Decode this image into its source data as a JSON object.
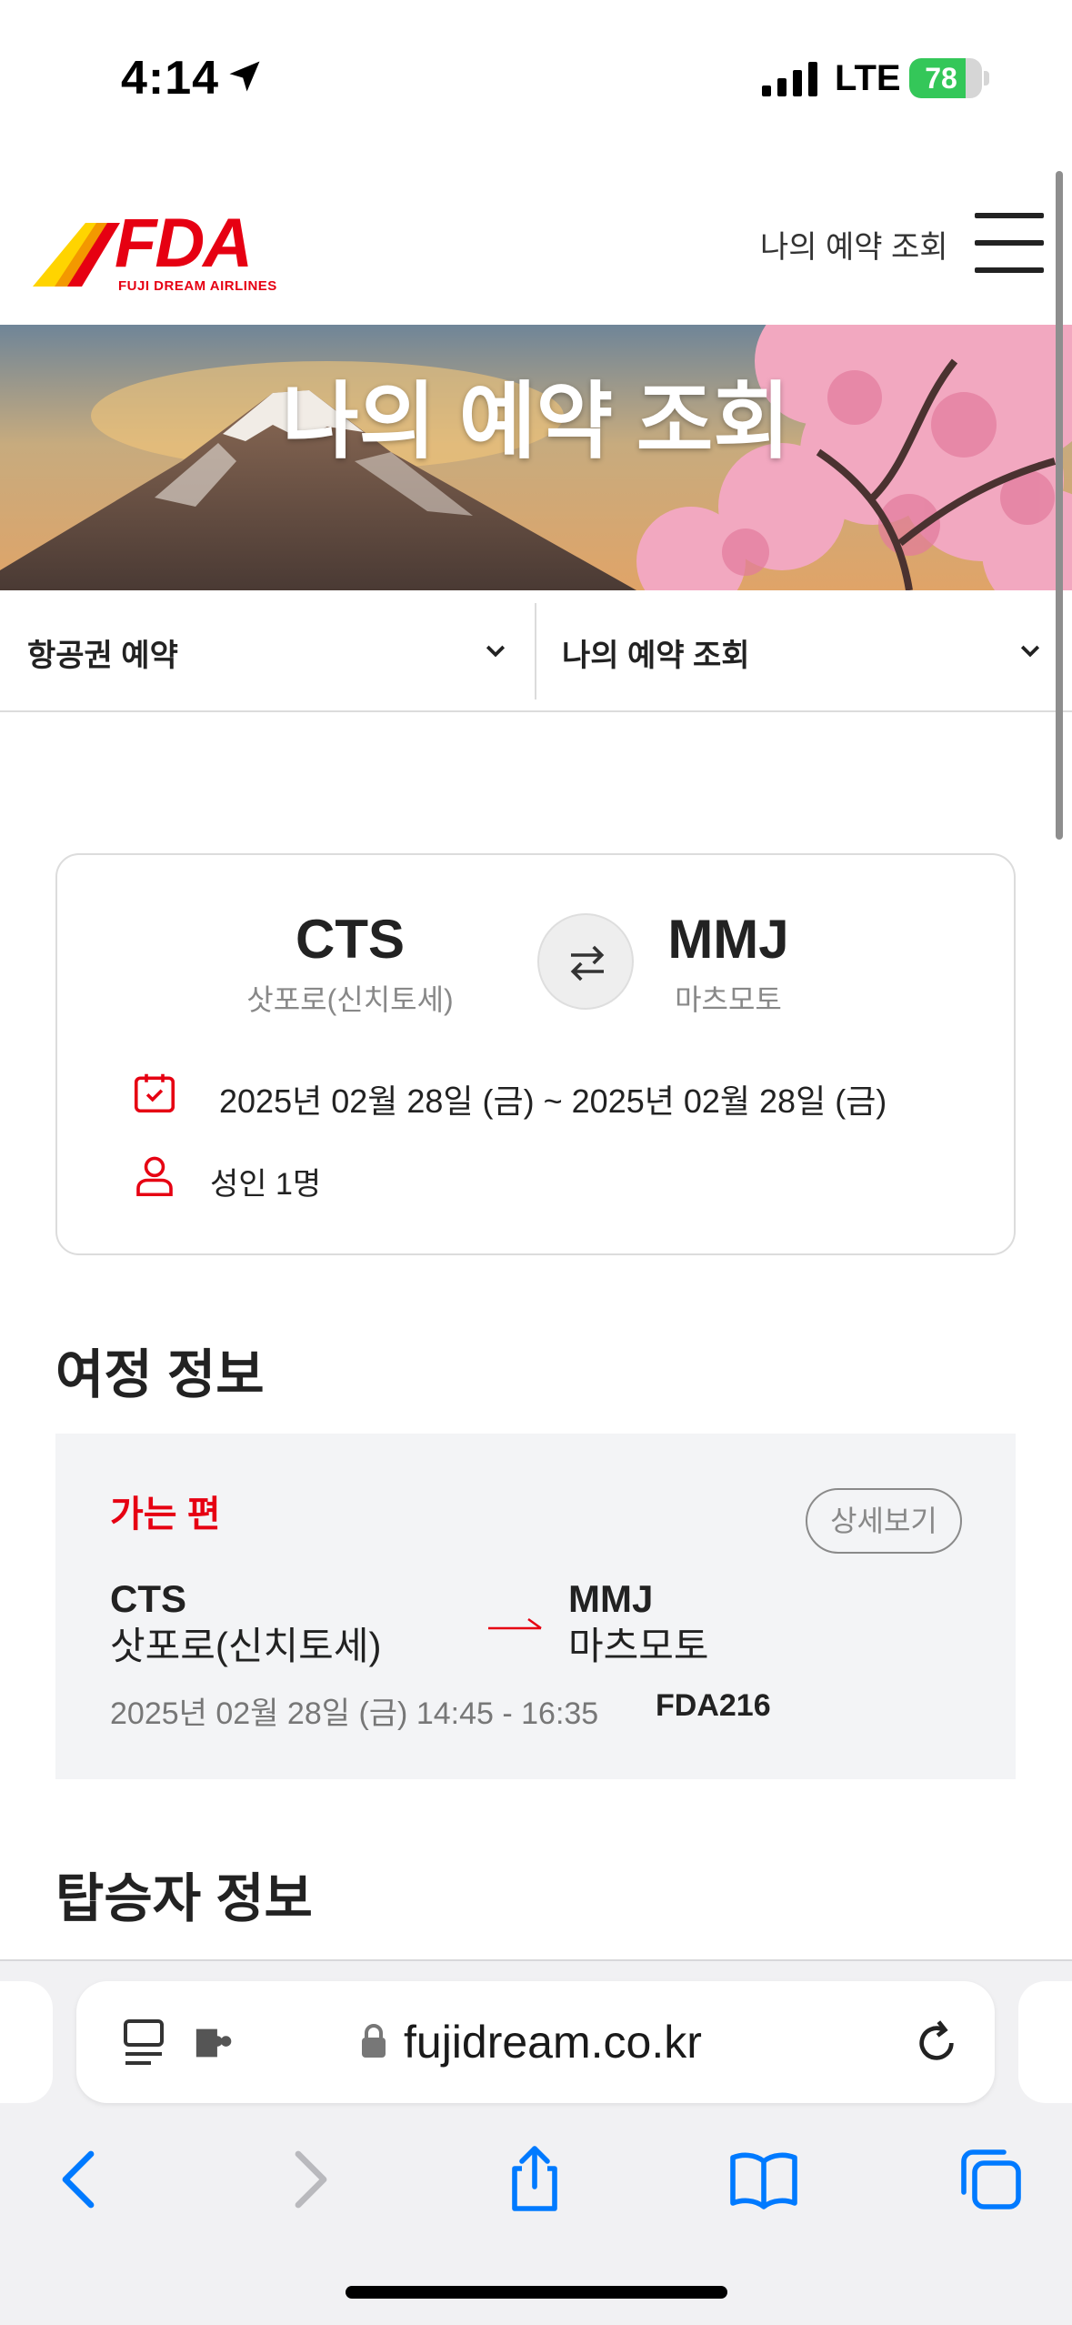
{
  "status_bar": {
    "time": "4:14",
    "network": "LTE",
    "battery_percent": "78",
    "battery_level": 0.78,
    "accent": "#34c759"
  },
  "header": {
    "logo_text": "FDA",
    "logo_subtitle": "FUJI DREAM AIRLINES",
    "nav_link": "나의 예약 조회",
    "brand_color": "#e60012"
  },
  "hero": {
    "title": "나의 예약 조회"
  },
  "tabs": [
    {
      "label": "항공권 예약"
    },
    {
      "label": "나의 예약 조회"
    }
  ],
  "search_summary": {
    "origin_code": "CTS",
    "origin_city": "삿포로(신치토세)",
    "dest_code": "MMJ",
    "dest_city": "마츠모토",
    "date_range": "2025년 02월 28일 (금) ~ 2025년 02월 28일 (금)",
    "passengers": "성인 1명"
  },
  "itinerary": {
    "section_title": "여정 정보",
    "direction_label": "가는 편",
    "detail_button": "상세보기",
    "origin_code": "CTS",
    "origin_city": "삿포로(신치토세)",
    "dest_code": "MMJ",
    "dest_city": "마츠모토",
    "datetime": "2025년 02월 28일 (금) 14:45 - 16:35",
    "flight_number": "FDA216"
  },
  "passenger_section": {
    "section_title": "탑승자 정보"
  },
  "browser": {
    "url": "fujidream.co.kr",
    "accent": "#007aff"
  }
}
